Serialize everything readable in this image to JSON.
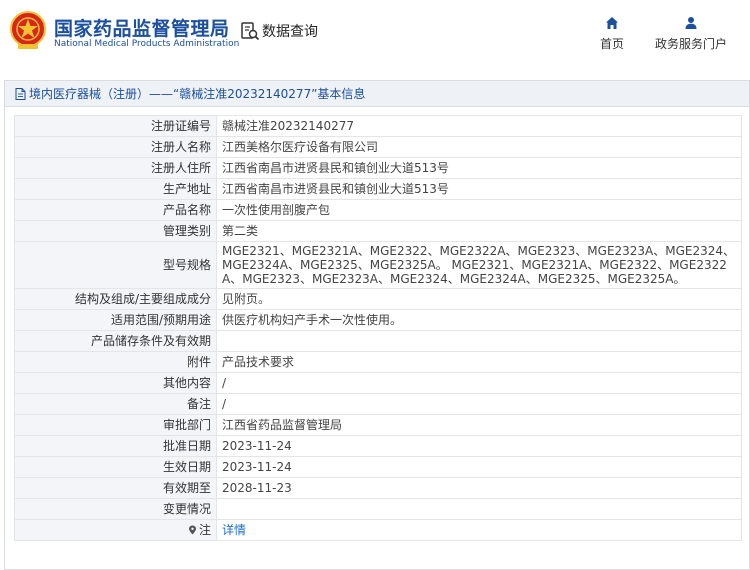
{
  "header": {
    "brand_cn": "国家药品监督管理局",
    "brand_en": "National Medical Products Administration",
    "query_label": "数据查询",
    "nav": [
      {
        "label": "首页",
        "icon": "home-icon"
      },
      {
        "label": "政务服务门户",
        "icon": "user-icon"
      }
    ]
  },
  "panel": {
    "title": "境内医疗器械（注册）——“赣械注准20232140277”基本信息"
  },
  "rows": [
    {
      "key": "注册证编号",
      "value": "赣械注准20232140277"
    },
    {
      "key": "注册人名称",
      "value": "江西美格尔医疗设备有限公司"
    },
    {
      "key": "注册人住所",
      "value": "江西省南昌市进贤县民和镇创业大道513号"
    },
    {
      "key": "生产地址",
      "value": "江西省南昌市进贤县民和镇创业大道513号"
    },
    {
      "key": "产品名称",
      "value": "一次性使用剖腹产包"
    },
    {
      "key": "管理类别",
      "value": "第二类"
    },
    {
      "key": "型号规格",
      "value": "MGE2321、MGE2321A、MGE2322、MGE2322A、MGE2323、MGE2323A、MGE2324、MGE2324A、MGE2325、MGE2325A。 MGE2321、MGE2321A、MGE2322、MGE2322A、MGE2323、MGE2323A、MGE2324、MGE2324A、MGE2325、MGE2325A。"
    },
    {
      "key": "结构及组成/主要组成成分",
      "value": "见附页。"
    },
    {
      "key": "适用范围/预期用途",
      "value": "供医疗机构妇产手术一次性使用。"
    },
    {
      "key": "产品储存条件及有效期",
      "value": ""
    },
    {
      "key": "附件",
      "value": "产品技术要求"
    },
    {
      "key": "其他内容",
      "value": "/"
    },
    {
      "key": "备注",
      "value": "/"
    },
    {
      "key": "审批部门",
      "value": "江西省药品监督管理局"
    },
    {
      "key": "批准日期",
      "value": "2023-11-24"
    },
    {
      "key": "生效日期",
      "value": "2023-11-24"
    },
    {
      "key": "有效期至",
      "value": "2028-11-23"
    },
    {
      "key": "变更情况",
      "value": ""
    },
    {
      "key": "注",
      "value": "详情"
    }
  ],
  "colors": {
    "brand_blue": "#1b4fa0",
    "link_blue": "#1b6fd1",
    "label_bg": "#f3f5f8",
    "logo_red": "#d8261d",
    "logo_gold": "#f2c230"
  }
}
